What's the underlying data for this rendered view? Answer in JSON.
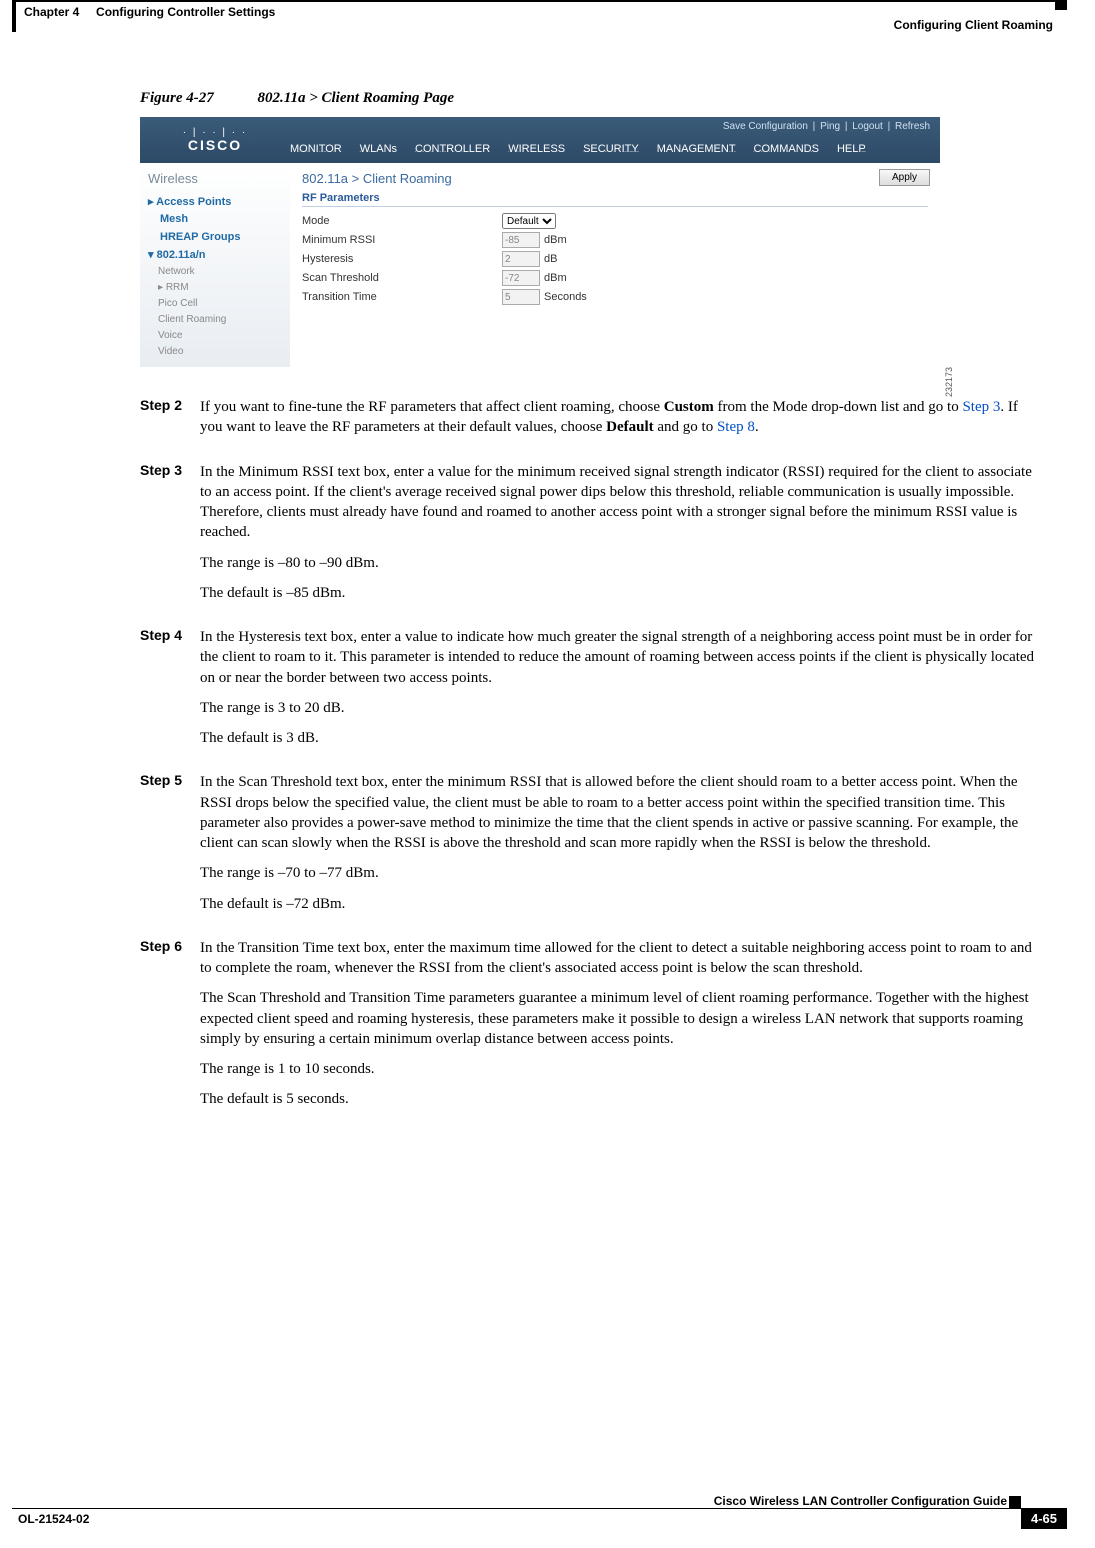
{
  "header": {
    "chapter": "Chapter 4",
    "title": "Configuring Controller Settings",
    "section": "Configuring Client Roaming"
  },
  "figure": {
    "label": "Figure 4-27",
    "title": "802.11a > Client Roaming Page",
    "id": "232173",
    "toplinks": [
      "Save Configuration",
      "Ping",
      "Logout",
      "Refresh"
    ],
    "brand_dots": "· | · · | · ·",
    "brand": "CISCO",
    "menu": [
      "MONITOR",
      "WLANs",
      "CONTROLLER",
      "WIRELESS",
      "SECURITY",
      "MANAGEMENT",
      "COMMANDS",
      "HELP"
    ],
    "side_heading": "Wireless",
    "side_items": {
      "access_points": "Access Points",
      "mesh": "Mesh",
      "hreap": "HREAP Groups",
      "band": "802.11a/n",
      "sub": [
        "Network",
        "RRM",
        "Pico Cell",
        "Client Roaming",
        "Voice",
        "Video"
      ]
    },
    "page_title": "802.11a > Client Roaming",
    "rf_section": "RF Parameters",
    "apply": "Apply",
    "rows": {
      "mode_label": "Mode",
      "mode_value": "Default",
      "min_rssi_label": "Minimum RSSI",
      "min_rssi_value": "-85",
      "min_rssi_unit": "dBm",
      "hysteresis_label": "Hysteresis",
      "hysteresis_value": "2",
      "hysteresis_unit": "dB",
      "scan_label": "Scan Threshold",
      "scan_value": "-72",
      "scan_unit": "dBm",
      "transition_label": "Transition Time",
      "transition_value": "5",
      "transition_unit": "Seconds"
    }
  },
  "steps": {
    "s2_label": "Step 2",
    "s2_p1a": "If you want to fine-tune the RF parameters that affect client roaming, choose ",
    "s2_p1b": "Custom",
    "s2_p1c": " from the Mode drop-down list and go to ",
    "s2_link1": "Step 3",
    "s2_p1d": ". If you want to leave the RF parameters at their default values, choose ",
    "s2_p1e": "Default",
    "s2_p1f": " and go to ",
    "s2_link2": "Step 8",
    "s2_p1g": ".",
    "s3_label": "Step 3",
    "s3_p1": "In the Minimum RSSI text box, enter a value for the minimum received signal strength indicator (RSSI) required for the client to associate to an access point. If the client's average received signal power dips below this threshold, reliable communication is usually impossible. Therefore, clients must already have found and roamed to another access point with a stronger signal before the minimum RSSI value is reached.",
    "s3_p2": "The range is –80 to –90 dBm.",
    "s3_p3": "The default is –85 dBm.",
    "s4_label": "Step 4",
    "s4_p1": "In the Hysteresis text box, enter a value to indicate how much greater the signal strength of a neighboring access point must be in order for the client to roam to it. This parameter is intended to reduce the amount of roaming between access points if the client is physically located on or near the border between two access points.",
    "s4_p2": "The range is 3 to 20 dB.",
    "s4_p3": "The default is 3 dB.",
    "s5_label": "Step 5",
    "s5_p1": "In the Scan Threshold text box, enter the minimum RSSI that is allowed before the client should roam to a better access point. When the RSSI drops below the specified value, the client must be able to roam to a better access point within the specified transition time. This parameter also provides a power-save method to minimize the time that the client spends in active or passive scanning. For example, the client can scan slowly when the RSSI is above the threshold and scan more rapidly when the RSSI is below the threshold.",
    "s5_p2": "The range is –70 to –77 dBm.",
    "s5_p3": "The default is –72 dBm.",
    "s6_label": "Step 6",
    "s6_p1": "In the Transition Time text box, enter the maximum time allowed for the client to detect a suitable neighboring access point to roam to and to complete the roam, whenever the RSSI from the client's associated access point is below the scan threshold.",
    "s6_p2": "The Scan Threshold and Transition Time parameters guarantee a minimum level of client roaming performance. Together with the highest expected client speed and roaming hysteresis, these parameters make it possible to design a wireless LAN network that supports roaming simply by ensuring a certain minimum overlap distance between access points.",
    "s6_p3": "The range is 1 to 10 seconds.",
    "s6_p4": "The default is 5 seconds."
  },
  "footer": {
    "guide": "Cisco Wireless LAN Controller Configuration Guide",
    "doc": "OL-21524-02",
    "page": "4-65"
  }
}
